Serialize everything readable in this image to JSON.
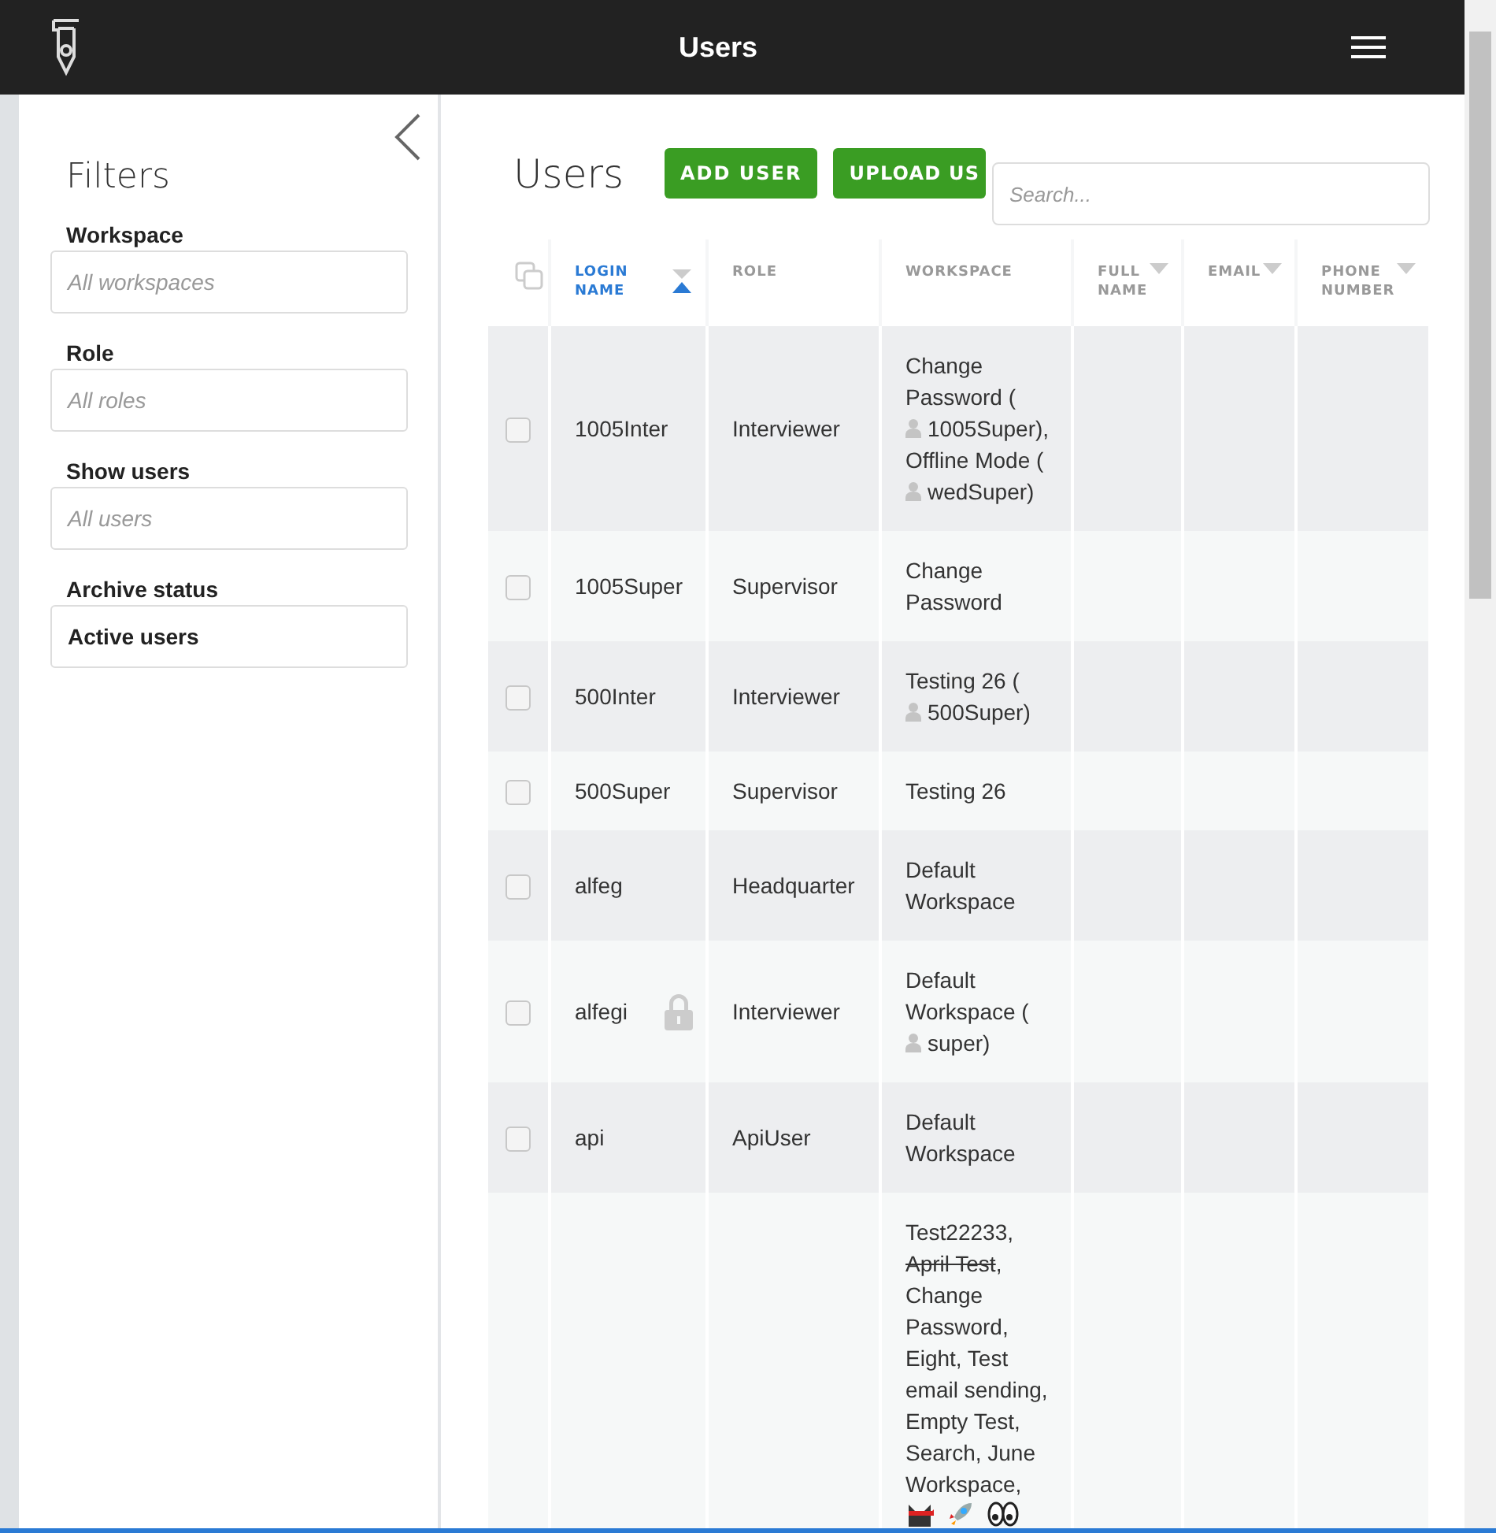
{
  "topbar": {
    "title": "Users"
  },
  "filters": {
    "title": "Filters",
    "fields": [
      {
        "label": "Workspace",
        "placeholder": "All workspaces"
      },
      {
        "label": "Role",
        "placeholder": "All roles"
      },
      {
        "label": "Show users",
        "placeholder": "All users"
      },
      {
        "label": "Archive status",
        "value": "Active users"
      }
    ]
  },
  "page": {
    "title": "Users",
    "buttons": [
      "ADD USER",
      "UPLOAD US"
    ],
    "search": {
      "placeholder": "Search..."
    }
  },
  "table": {
    "columns": [
      {
        "label": "LOGIN NAME",
        "sortable": true,
        "sorted": true
      },
      {
        "label": "ROLE",
        "sortable": false,
        "sorted": false
      },
      {
        "label": "WORKSPACE",
        "sortable": false,
        "sorted": false
      },
      {
        "label": "FULL NAME",
        "sortable": true,
        "sorted": false
      },
      {
        "label": "EMAIL",
        "sortable": true,
        "sorted": false
      },
      {
        "label": "PHONE NUMBER",
        "sortable": true,
        "sorted": false
      }
    ],
    "rows": [
      {
        "checked": false,
        "login": "1005Inter",
        "role": "Interviewer",
        "locked": false,
        "workspace": [
          {
            "kind": "text",
            "text": "Change Password ("
          },
          {
            "kind": "user",
            "text": "1005Super),"
          },
          {
            "kind": "text",
            "text": "Offline Mode ("
          },
          {
            "kind": "user",
            "text": "wedSuper)"
          }
        ]
      },
      {
        "checked": false,
        "login": "1005Super",
        "role": "Supervisor",
        "locked": false,
        "workspace": [
          {
            "kind": "text",
            "text": "Change Password"
          }
        ]
      },
      {
        "checked": false,
        "login": "500Inter",
        "role": "Interviewer",
        "locked": false,
        "workspace": [
          {
            "kind": "text",
            "text": "Testing 26 ("
          },
          {
            "kind": "user",
            "text": "500Super)"
          }
        ]
      },
      {
        "checked": false,
        "login": "500Super",
        "role": "Supervisor",
        "locked": false,
        "workspace": [
          {
            "kind": "text",
            "text": "Testing 26"
          }
        ]
      },
      {
        "checked": false,
        "login": "alfeg",
        "role": "Headquarter",
        "locked": false,
        "workspace": [
          {
            "kind": "text",
            "text": "Default Workspace"
          }
        ]
      },
      {
        "checked": false,
        "login": "alfegi",
        "role": "Interviewer",
        "locked": true,
        "workspace": [
          {
            "kind": "text",
            "text": "Default Workspace ("
          },
          {
            "kind": "user",
            "text": "super)"
          }
        ]
      },
      {
        "checked": false,
        "login": "api",
        "role": "ApiUser",
        "locked": false,
        "workspace": [
          {
            "kind": "text",
            "text": "Default Workspace"
          }
        ]
      },
      {
        "workspace": [
          {
            "kind": "text",
            "text": "Test22233,"
          },
          {
            "kind": "archived",
            "text": "April Test",
            "suffix": ","
          },
          {
            "kind": "text",
            "text": "Change Password, Eight, Test email sending, Empty Test, Search, June Workspace,"
          },
          {
            "kind": "ninja-cat"
          },
          {
            "kind": "rocket"
          },
          {
            "kind": "eyes"
          }
        ]
      }
    ]
  }
}
